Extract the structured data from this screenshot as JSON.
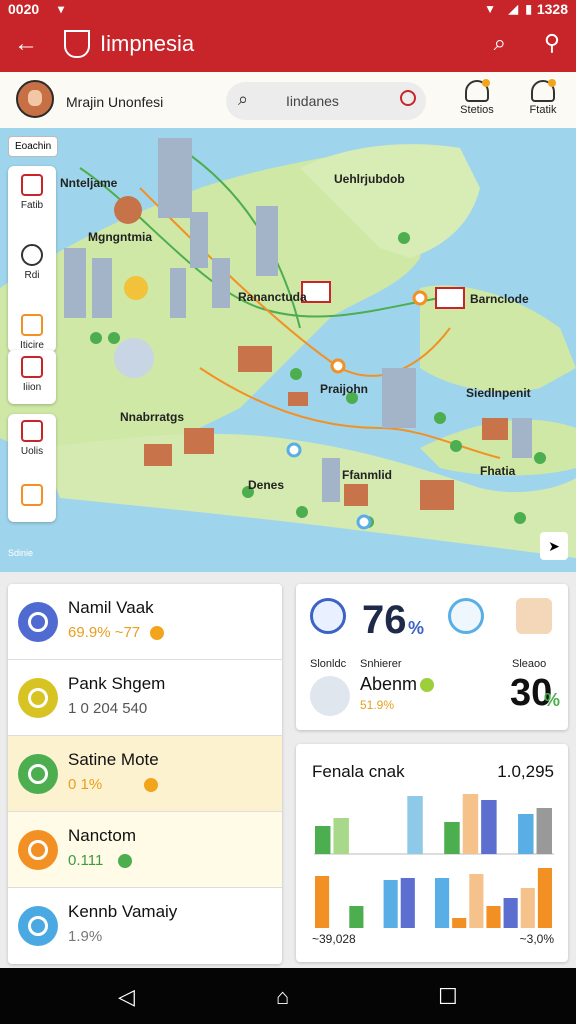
{
  "status": {
    "time": "0020",
    "right": "1328"
  },
  "appbar": {
    "title": "Iimpnesia"
  },
  "search": {
    "greeting": "Mrajin Unonfesi",
    "placeholder": "Iindanes",
    "btn1": "Stetios",
    "btn2": "Ftatik"
  },
  "map": {
    "chip": "Eoachin",
    "labels": [
      "Nnteljame",
      "Mgngntmia",
      "Uehlrjubdob",
      "Rananctuda",
      "Barnclode",
      "Nnabrratgs",
      "Siedlnpenit",
      "Praijohn",
      "Ffanmlid",
      "Fhatia",
      "Denes"
    ],
    "side_items": [
      "Fatib",
      "Rdi",
      "Iticire",
      "Iiion",
      "Uolis"
    ],
    "legal": "Sdinie"
  },
  "list": [
    {
      "name": "Namil Vaak",
      "value": "69.9% ~77",
      "color": "#4f6bd1",
      "dot": "#f2a51c",
      "valcolor": "#e6a020"
    },
    {
      "name": "Pank Shgem",
      "value": "1 0 204 540",
      "color": "#d7c423",
      "dot": "",
      "valcolor": "#555"
    },
    {
      "name": "Satine Mote",
      "value": "0 1%",
      "color": "#4cae4f",
      "dot": "#f2a51c",
      "valcolor": "#e6a020"
    },
    {
      "name": "Nanctom",
      "value": "0.111",
      "color": "#f39023",
      "dot": "#4cae4f",
      "valcolor": "#3a9c3f"
    },
    {
      "name": "Kennb Vamaiy",
      "value": "1.9%",
      "color": "#4aa9e2",
      "dot": "",
      "valcolor": "#777"
    }
  ],
  "stats": {
    "big1": "76",
    "big1_unit": "%",
    "label1": "Slonldc",
    "label2": "Snhierer",
    "label3": "Sleaoo",
    "name": "Abenm",
    "name_pct": "51.9%",
    "big2": "30",
    "big2_unit": "%"
  },
  "chart_data": {
    "type": "bar",
    "title": "Fenala cnak",
    "top_value": "1.0,295",
    "x_left": "~39,028",
    "x_right": "~3,0%",
    "series": [
      {
        "values": [
          28,
          36,
          0,
          0,
          0,
          58,
          0,
          32,
          60,
          54,
          0,
          40,
          46
        ]
      },
      {
        "values": [
          52,
          0,
          22,
          0,
          48,
          50,
          0,
          50,
          10,
          54,
          22,
          30,
          40,
          60
        ]
      }
    ],
    "colors_top": [
      "#4cae4f",
      "#a8d98a",
      "#ffffff",
      "#ffffff",
      "#ffffff",
      "#8ecae8",
      "#ffffff",
      "#4cae4f",
      "#f6c28b",
      "#5c6fd1",
      "#a8d98a",
      "#5aaee6"
    ],
    "colors_bottom": [
      "#f39023",
      "#ffffff",
      "#4cae4f",
      "#ffffff",
      "#5aaee6",
      "#5c6fd1",
      "#ffffff",
      "#5aaee6",
      "#f39023",
      "#f6c28b",
      "#f39023",
      "#5c6fd1",
      "#f6c28b",
      "#f39023"
    ]
  }
}
